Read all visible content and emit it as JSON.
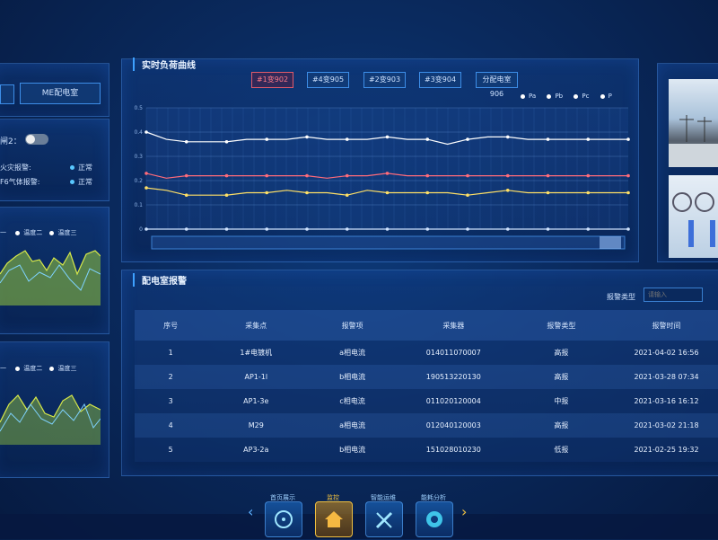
{
  "left": {
    "tabs": [
      "ME配电室"
    ],
    "switch_label": "闸2：",
    "alarms": [
      {
        "label": "火灾报警:",
        "status": "正常"
      },
      {
        "label": "F6气体报警:",
        "status": "正常"
      }
    ],
    "legend1": [
      "一",
      "温度二",
      "温度三"
    ],
    "legend2": [
      "一",
      "温度二",
      "温度三"
    ]
  },
  "load_curve": {
    "title": "实时负荷曲线",
    "tabs": [
      "#1变902",
      "#4变905",
      "#2变903",
      "#3变904",
      "分配电室906"
    ],
    "active_tab": 0,
    "legend": [
      "Pa",
      "Pb",
      "Pc",
      "P"
    ]
  },
  "alarm_panel": {
    "title": "配电室报警",
    "filter_label": "报警类型",
    "filter_placeholder": "请输入",
    "columns": [
      "序号",
      "采集点",
      "报警项",
      "采集器",
      "报警类型",
      "报警时间"
    ],
    "rows": [
      [
        "1",
        "1#电镀机",
        "a相电流",
        "014011070007",
        "高报",
        "2021-04-02 16:56"
      ],
      [
        "2",
        "AP1-1l",
        "b相电流",
        "190513220130",
        "高报",
        "2021-03-28 07:34"
      ],
      [
        "3",
        "AP1-3e",
        "c相电流",
        "011020120004",
        "中报",
        "2021-03-16 16:12"
      ],
      [
        "4",
        "M29",
        "a相电流",
        "012040120003",
        "高报",
        "2021-03-02 21:18"
      ],
      [
        "5",
        "AP3-2a",
        "b相电流",
        "151028010230",
        "低报",
        "2021-02-25 19:32"
      ]
    ]
  },
  "bottom_nav": [
    "首页展示",
    "监控",
    "智能运维",
    "能耗分析"
  ],
  "chart_data": {
    "type": "line",
    "title": "实时负荷曲线",
    "x": [
      "0",
      "1",
      "2",
      "3",
      "4",
      "5",
      "6",
      "7",
      "8",
      "9",
      "10",
      "11",
      "12",
      "13",
      "14",
      "15",
      "16",
      "17",
      "18",
      "19",
      "20",
      "21",
      "22",
      "23",
      "24"
    ],
    "ylim": [
      0,
      0.5
    ],
    "yticks": [
      "0",
      "0.1",
      "0.2",
      "0.3",
      "0.4",
      "0.5"
    ],
    "series": [
      {
        "name": "Pa",
        "color": "#ffe066",
        "values": [
          0.17,
          0.16,
          0.14,
          0.14,
          0.14,
          0.15,
          0.15,
          0.16,
          0.15,
          0.15,
          0.14,
          0.16,
          0.15,
          0.15,
          0.15,
          0.15,
          0.14,
          0.15,
          0.16,
          0.15,
          0.15,
          0.15,
          0.15,
          0.15,
          0.15
        ]
      },
      {
        "name": "Pb",
        "color": "#ffffff",
        "values": [
          0.4,
          0.37,
          0.36,
          0.36,
          0.36,
          0.37,
          0.37,
          0.37,
          0.38,
          0.37,
          0.37,
          0.37,
          0.38,
          0.37,
          0.37,
          0.35,
          0.37,
          0.38,
          0.38,
          0.37,
          0.37,
          0.37,
          0.37,
          0.37,
          0.37
        ]
      },
      {
        "name": "Pc",
        "color": "#ff6b7a",
        "values": [
          0.23,
          0.21,
          0.22,
          0.22,
          0.22,
          0.22,
          0.22,
          0.22,
          0.22,
          0.21,
          0.22,
          0.22,
          0.23,
          0.22,
          0.22,
          0.22,
          0.22,
          0.22,
          0.22,
          0.22,
          0.22,
          0.22,
          0.22,
          0.22,
          0.22
        ]
      },
      {
        "name": "P",
        "color": "#cfe3ff",
        "values": [
          0.0,
          0.0,
          0.0,
          0.0,
          0.0,
          0.0,
          0.0,
          0.0,
          0.0,
          0.0,
          0.0,
          0.0,
          0.0,
          0.0,
          0.0,
          0.0,
          0.0,
          0.0,
          0.0,
          0.0,
          0.0,
          0.0,
          0.0,
          0.0,
          0.0
        ]
      }
    ]
  }
}
